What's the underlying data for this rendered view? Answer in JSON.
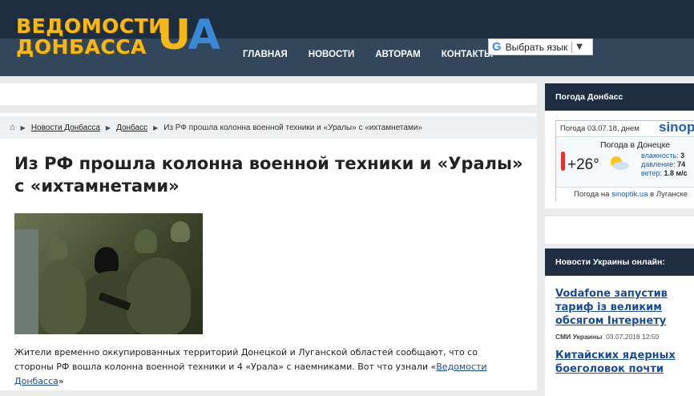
{
  "header": {
    "logo_line1": "ВЕДОМОСТИ",
    "logo_line2": "ДОНБАССА",
    "logo_ua_u": "U",
    "logo_ua_a": "A",
    "nav": [
      "ГЛАВНАЯ",
      "НОВОСТИ",
      "АВТОРАМ",
      "КОНТАКТЫ"
    ],
    "translate_label": "Выбрать язык",
    "translate_icon": "G",
    "translate_arrow": "▼"
  },
  "breadcrumb": {
    "home_icon": "home-icon",
    "items": [
      "Новости Донбасса",
      "Донбасс"
    ],
    "current": "Из РФ прошла колонна военной техники и «Уралы» с «ихтамнетами»"
  },
  "article": {
    "title": "Из РФ прошла колонна военной техники и «Уралы» с «ихтамнетами»",
    "body_before": "Жители временно оккупированных территорий Донецкой и Луганской областей сообщают, что со стороны РФ вошла колонна военной техники и 4 «Урала» с наемниками. Вот что узнали «",
    "body_link": "Ведомости Донбасса",
    "body_after": "»"
  },
  "sidebar": {
    "weather_title": "Погода Донбасс",
    "weather": {
      "date": "Погода 03.07.18, днем",
      "brand": "sinop",
      "city": "Погода в Донецке",
      "temp": "+26°",
      "humidity_label": "влажность:",
      "humidity": "3",
      "pressure_label": "давление:",
      "pressure": "74",
      "wind_label": "ветер:",
      "wind": "1.8 м/с",
      "footer_prefix": "Погода на ",
      "footer_link": "sinoptik.ua",
      "footer_suffix": " в Луганске"
    },
    "news_title": "Новости Украины онлайн:",
    "news": [
      {
        "title": "Vodafone запустив тариф із великим обсягом Інтернету",
        "source": "СМИ Украины",
        "date": "03.07.2018 12:50"
      },
      {
        "title": "Китайских ядерных боеголовок почти",
        "source": "",
        "date": ""
      }
    ]
  }
}
